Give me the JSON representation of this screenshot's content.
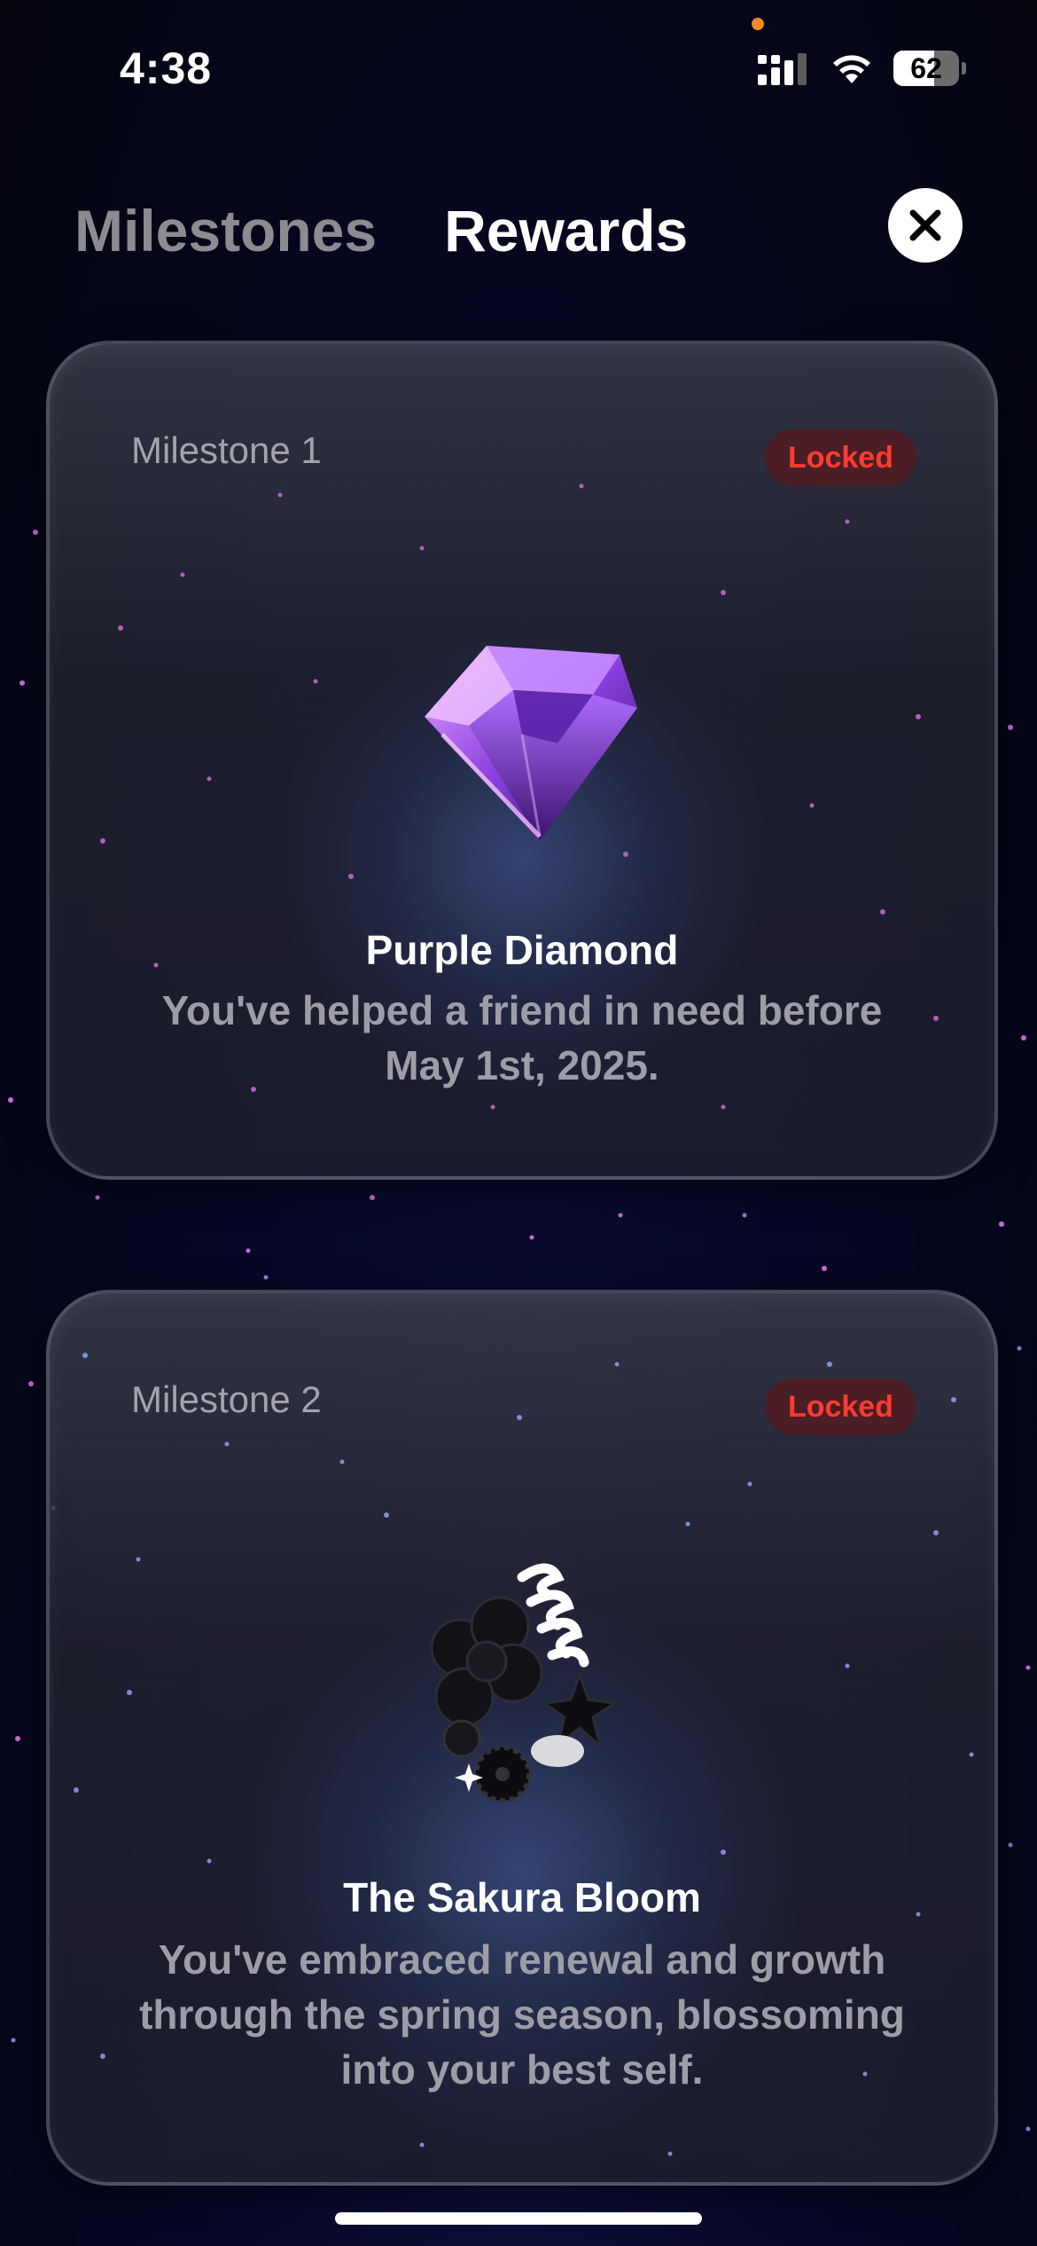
{
  "status_bar": {
    "time": "4:38",
    "battery_level": "62",
    "battery_fraction": 0.62
  },
  "tabs": [
    {
      "label": "Milestones",
      "active": false
    },
    {
      "label": "Rewards",
      "active": true
    }
  ],
  "close_icon": "close-icon",
  "cards": [
    {
      "milestone": "Milestone 1",
      "status": "Locked",
      "reward_name": "Purple Diamond",
      "description": "You've helped a friend in need before May 1st, 2025.",
      "icon": "purple-diamond-icon"
    },
    {
      "milestone": "Milestone 2",
      "status": "Locked",
      "reward_name": "The Sakura Bloom",
      "description": "You've embraced renewal and growth through the spring season, blossoming into your best self.",
      "icon": "sakura-bloom-icon"
    }
  ],
  "colors": {
    "locked_text": "#ff3b30",
    "locked_bg": "#4a1e24",
    "tab_active": "#ffffff",
    "tab_inactive": "#8b8b90"
  }
}
